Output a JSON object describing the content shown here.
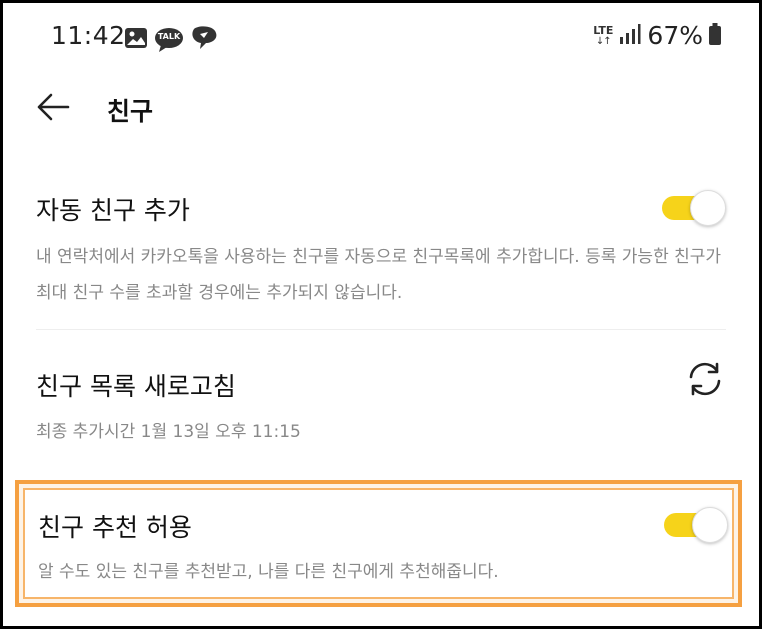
{
  "status_bar": {
    "time": "11:42",
    "left_icons": [
      "gallery-icon",
      "kakaotalk-talk-icon",
      "chat-bubble-icon"
    ],
    "talk_badge_label": "TALK",
    "network_label": "LTE",
    "network_arrows": "↓↑",
    "battery_percent": "67%"
  },
  "header": {
    "title": "친구",
    "back_icon": "back-arrow-icon"
  },
  "settings": {
    "auto_add": {
      "title": "자동 친구 추가",
      "description": "내 연락처에서 카카오톡을 사용하는 친구를 자동으로 친구목록에 추가합니다. 등록 가능한 친구가 최대 친구 수를 초과할 경우에는 추가되지 않습니다.",
      "enabled": true
    },
    "refresh": {
      "title": "친구 목록 새로고침",
      "description": "최종 추가시간 1월 13일 오후 11:15",
      "icon": "refresh-icon"
    },
    "recommend": {
      "title": "친구 추천 허용",
      "description": "알 수도 있는 친구를 추천받고, 나를 다른 친구에게 추천해줍니다.",
      "enabled": true
    }
  },
  "colors": {
    "toggle_on": "#f6d31a",
    "highlight_border": "#f5a041",
    "description_text": "#888888"
  }
}
